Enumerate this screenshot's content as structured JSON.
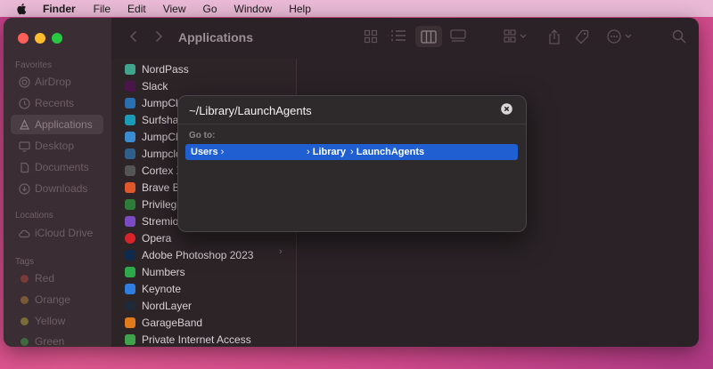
{
  "menubar": {
    "app": "Finder",
    "items": [
      "File",
      "Edit",
      "View",
      "Go",
      "Window",
      "Help"
    ]
  },
  "sidebar": {
    "favorites_title": "Favorites",
    "favorites": [
      {
        "label": "AirDrop",
        "icon": "airdrop-icon"
      },
      {
        "label": "Recents",
        "icon": "clock-icon"
      },
      {
        "label": "Applications",
        "icon": "applications-icon"
      },
      {
        "label": "Desktop",
        "icon": "desktop-icon"
      },
      {
        "label": "Documents",
        "icon": "document-icon"
      },
      {
        "label": "Downloads",
        "icon": "download-icon"
      }
    ],
    "locations_title": "Locations",
    "locations": [
      {
        "label": "iCloud Drive",
        "icon": "cloud-icon"
      }
    ],
    "tags_title": "Tags",
    "tags": [
      {
        "label": "Red",
        "color": "#7a3a3a"
      },
      {
        "label": "Orange",
        "color": "#7a5a35"
      },
      {
        "label": "Yellow",
        "color": "#786d36"
      },
      {
        "label": "Green",
        "color": "#3f6a3f"
      }
    ]
  },
  "toolbar": {
    "title": "Applications"
  },
  "files": [
    {
      "name": "NordPass",
      "color": "#3fa58c"
    },
    {
      "name": "Slack",
      "color": "#4a154b"
    },
    {
      "name": "JumpCl",
      "color": "#2a6fb0"
    },
    {
      "name": "Surfsha",
      "color": "#1c9bb8"
    },
    {
      "name": "JumpCl",
      "color": "#3b8bd1"
    },
    {
      "name": "Jumpclo",
      "color": "#2f5f8a"
    },
    {
      "name": "Cortex X",
      "color": "#555555"
    },
    {
      "name": "Brave B",
      "color": "#e0572b"
    },
    {
      "name": "Privilege",
      "color": "#2d7c3a"
    },
    {
      "name": "Stremio",
      "color": "#7b4bc4"
    },
    {
      "name": "Opera",
      "color": "#d8232a"
    },
    {
      "name": "Adobe Photoshop 2023",
      "color": "#0f2a4a"
    },
    {
      "name": "Numbers",
      "color": "#2da84a"
    },
    {
      "name": "Keynote",
      "color": "#2f7de1"
    },
    {
      "name": "NordLayer",
      "color": "#1e2a3a"
    },
    {
      "name": "GarageBand",
      "color": "#e07a1d"
    },
    {
      "name": "Private Internet Access",
      "color": "#3fa34d"
    }
  ],
  "dialog": {
    "path_value": "~/Library/LaunchAgents",
    "go_to_label": "Go to:",
    "suggestion": {
      "seg1": "Users",
      "seg2": "Library",
      "seg3": "LaunchAgents"
    }
  }
}
